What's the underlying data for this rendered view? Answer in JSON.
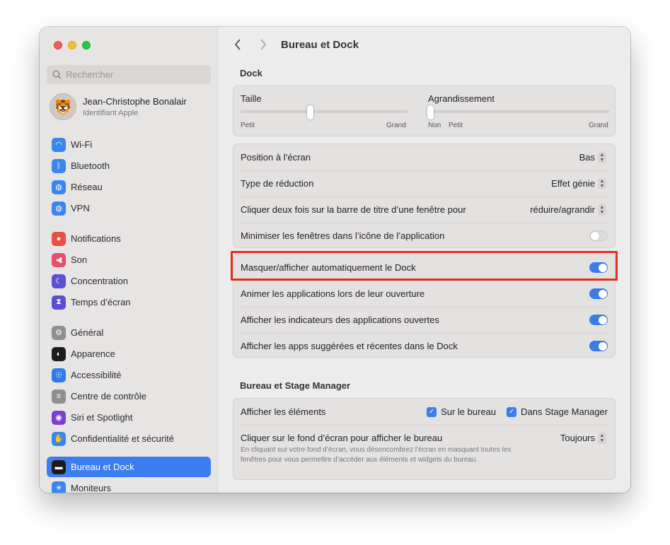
{
  "window": {
    "title": "Bureau et Dock"
  },
  "sidebar": {
    "search_placeholder": "Rechercher",
    "profile": {
      "name": "Jean-Christophe Bonalair",
      "subtitle": "Identifiant Apple",
      "avatar_emoji": "🐯"
    },
    "items": [
      {
        "label": "Wi-Fi",
        "icon": "wifi-icon",
        "color": "#3a86f0"
      },
      {
        "label": "Bluetooth",
        "icon": "bluetooth-icon",
        "color": "#3a86f0"
      },
      {
        "label": "Réseau",
        "icon": "globe-icon",
        "color": "#3a86f0"
      },
      {
        "label": "VPN",
        "icon": "vpn-globe-icon",
        "color": "#3a86f0"
      },
      {
        "label": "Notifications",
        "icon": "bell-icon",
        "color": "#ea4d44"
      },
      {
        "label": "Son",
        "icon": "speaker-icon",
        "color": "#ea4d6a"
      },
      {
        "label": "Concentration",
        "icon": "moon-icon",
        "color": "#5b4fd3"
      },
      {
        "label": "Temps d’écran",
        "icon": "hourglass-icon",
        "color": "#5b4fd3"
      },
      {
        "label": "Général",
        "icon": "gear-icon",
        "color": "#8e8e93"
      },
      {
        "label": "Apparence",
        "icon": "appearance-icon",
        "color": "#1c1c1e"
      },
      {
        "label": "Accessibilité",
        "icon": "accessibility-icon",
        "color": "#2f7be9"
      },
      {
        "label": "Centre de contrôle",
        "icon": "control-center-icon",
        "color": "#8e8e93"
      },
      {
        "label": "Siri et Spotlight",
        "icon": "siri-icon",
        "color": "#7b3fd0"
      },
      {
        "label": "Confidentialité et sécurité",
        "icon": "hand-icon",
        "color": "#3a86f0"
      },
      {
        "label": "Bureau et Dock",
        "icon": "dock-icon",
        "color": "#1c1c1e",
        "active": true
      },
      {
        "label": "Moniteurs",
        "icon": "sun-icon",
        "color": "#3a86f0"
      }
    ]
  },
  "main": {
    "dock_section": "Dock",
    "size": {
      "label": "Taille",
      "min": "Petit",
      "max": "Grand",
      "value_fraction": 0.38
    },
    "magnification": {
      "label": "Agrandissement",
      "none": "Non",
      "min": "Petit",
      "max": "Grand",
      "value_fraction": 0.0
    },
    "rows1": [
      {
        "label": "Position à l’écran",
        "value": "Bas"
      },
      {
        "label": "Type de réduction",
        "value": "Effet génie"
      },
      {
        "label": "Cliquer deux fois sur la barre de titre d’une fenêtre pour",
        "value": "réduire/agrandir"
      },
      {
        "label": "Minimiser les fenêtres dans l’icône de l’application",
        "toggle": false
      }
    ],
    "rows2": [
      {
        "label": "Masquer/afficher automatiquement le Dock",
        "toggle": true
      },
      {
        "label": "Animer les applications lors de leur ouverture",
        "toggle": true
      },
      {
        "label": "Afficher les indicateurs des applications ouvertes",
        "toggle": true
      },
      {
        "label": "Afficher les apps suggérées et récentes dans le Dock",
        "toggle": true
      }
    ],
    "stage_section": "Bureau et Stage Manager",
    "show_items": {
      "label": "Afficher les éléments",
      "opt1": "Sur le bureau",
      "opt2": "Dans Stage Manager"
    },
    "click_wallpaper": {
      "label": "Cliquer sur le fond d’écran pour afficher le bureau",
      "value": "Toujours",
      "description": "En cliquant sur votre fond d’écran, vous désencombrez l’écran en masquant toutes les fenêtres pour vous permettre d’accéder aux éléments et widgets du bureau."
    }
  }
}
